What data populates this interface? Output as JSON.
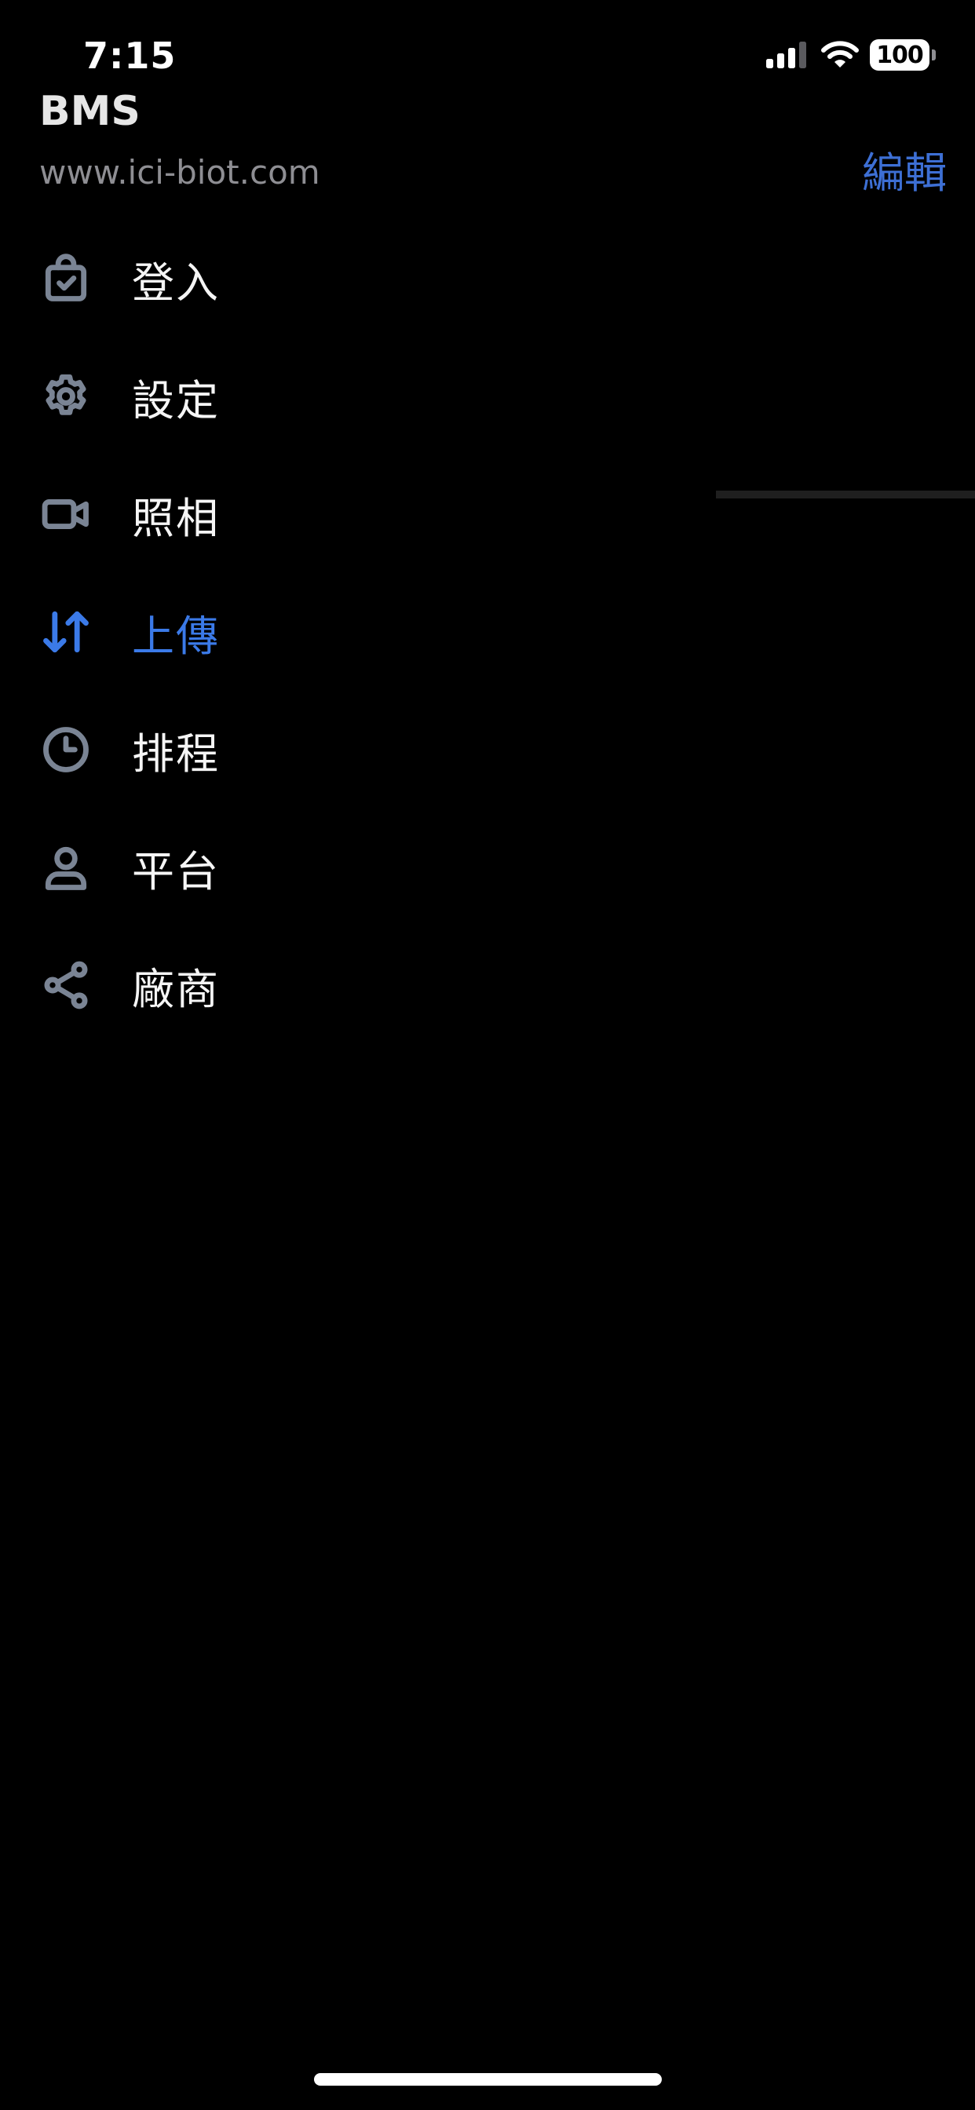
{
  "status_bar": {
    "time": "7:15",
    "battery": "100",
    "icons": [
      "signal-icon",
      "wifi-icon",
      "battery-icon"
    ]
  },
  "drawer": {
    "title": "BMS",
    "subtitle": "www.ici-biot.com",
    "items": [
      {
        "label": "登入",
        "icon": "login-bag-icon",
        "active": false
      },
      {
        "label": "設定",
        "icon": "gear-icon",
        "active": false
      },
      {
        "label": "照相",
        "icon": "video-camera-icon",
        "active": false
      },
      {
        "label": "上傳",
        "icon": "transfer-arrows-icon",
        "active": true
      },
      {
        "label": "排程",
        "icon": "clock-icon",
        "active": false
      },
      {
        "label": "平台",
        "icon": "user-icon",
        "active": false
      },
      {
        "label": "廠商",
        "icon": "share-icon",
        "active": false
      }
    ]
  },
  "header": {
    "edit_label": "編輯"
  },
  "colors": {
    "background": "#000000",
    "accent": "#3b7ae8",
    "edit_button": "#3d6fd4",
    "icon_default": "#7a8494",
    "subtitle": "#8e8e93"
  }
}
